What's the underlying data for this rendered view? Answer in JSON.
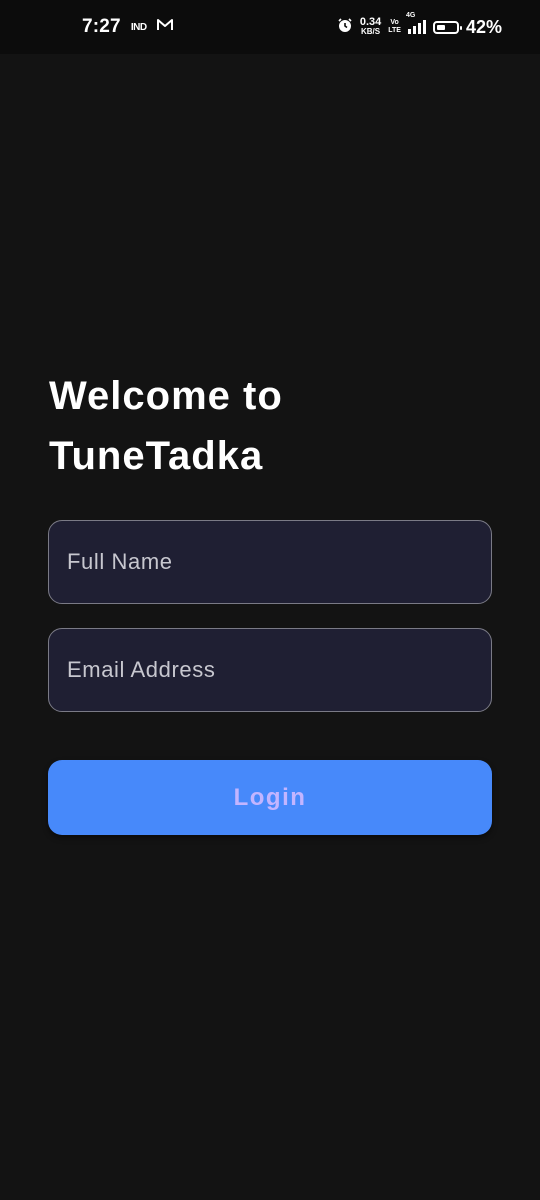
{
  "status_bar": {
    "time": "7:27",
    "carrier": "IND",
    "notification_icon": "gmail-icon",
    "alarm_icon": "alarm-icon",
    "net_speed_value": "0.34",
    "net_speed_unit": "KB/S",
    "volte_top": "Vo",
    "volte_bottom": "LTE",
    "network_type": "4G",
    "battery_level": 0.42,
    "battery_percent": "42%"
  },
  "welcome": {
    "line1": "Welcome to",
    "line2": "TuneTadka"
  },
  "form": {
    "name_placeholder": "Full Name",
    "name_value": "",
    "email_placeholder": "Email Address",
    "email_value": "",
    "login_label": "Login"
  },
  "colors": {
    "background": "#131313",
    "field_background": "#1f1f33",
    "field_border": "#7a7a86",
    "button_background": "#4789fa",
    "button_text": "#c3b5ff"
  }
}
